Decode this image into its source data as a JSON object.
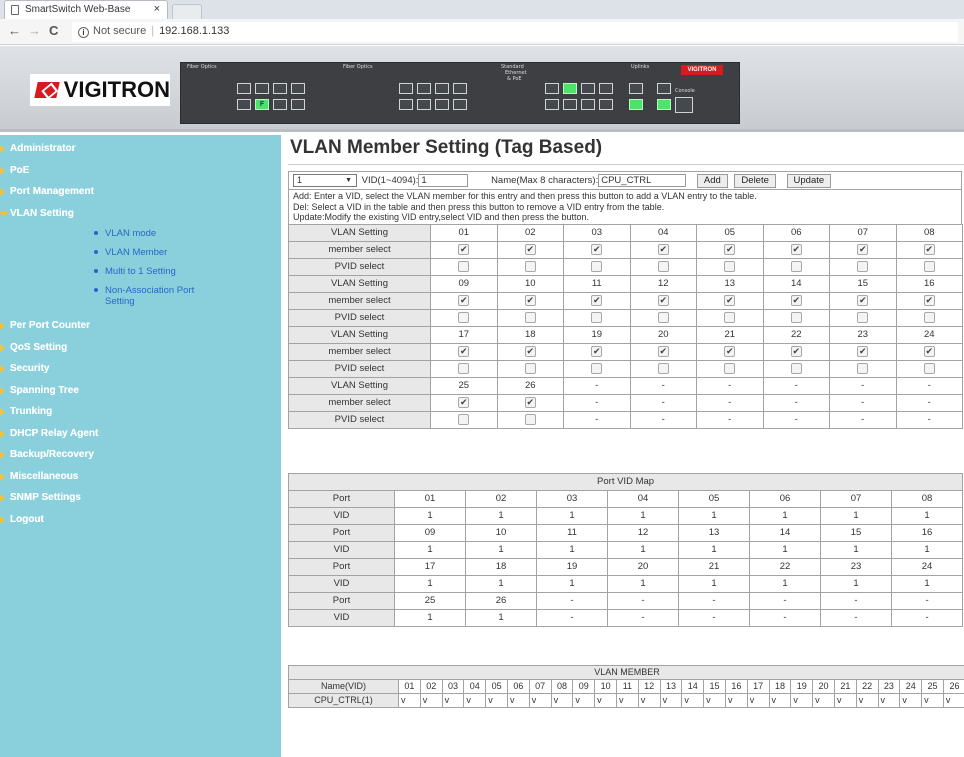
{
  "browser": {
    "tab_title": "SmartSwitch Web-Base",
    "tab_close": "×",
    "nav_back": "←",
    "nav_forward": "→",
    "nav_reload": "C",
    "security_label": "Not secure",
    "url": "192.168.1.133"
  },
  "banner": {
    "logo_text": "VIGITRON",
    "labels": {
      "fiber1": "Fiber Optics",
      "fiber2": "Fiber Optics",
      "standard": "Standard",
      "ethernet": "Ethernet",
      "poe": "& PoE",
      "uplinks": "Uplinks",
      "console": "Console",
      "brand": "VIGITRON",
      "f": "F"
    }
  },
  "sidebar": {
    "items": [
      {
        "label": "Administrator"
      },
      {
        "label": "PoE"
      },
      {
        "label": "Port Management"
      },
      {
        "label": "VLAN Setting"
      },
      {
        "label": "Per Port Counter"
      },
      {
        "label": "QoS Setting"
      },
      {
        "label": "Security"
      },
      {
        "label": "Spanning Tree"
      },
      {
        "label": "Trunking"
      },
      {
        "label": "DHCP Relay Agent"
      },
      {
        "label": "Backup/Recovery"
      },
      {
        "label": "Miscellaneous"
      },
      {
        "label": "SNMP Settings"
      },
      {
        "label": "Logout"
      }
    ],
    "vlan_sub": [
      {
        "label": "VLAN mode"
      },
      {
        "label": "VLAN Member"
      },
      {
        "label": "Multi to 1 Setting"
      },
      {
        "label": "Non-Association Port Setting"
      }
    ]
  },
  "main": {
    "title": "VLAN Member Setting (Tag Based)",
    "controls": {
      "vid_select_value": "1",
      "vid_label": "VID(1~4094):",
      "vid_value": "1",
      "name_label": "Name(Max 8 characters):",
      "name_value": "CPU_CTRL",
      "add_label": "Add",
      "delete_label": "Delete",
      "update_label": "Update"
    },
    "help": {
      "line1": "Add: Enter a VID, select the VLAN member for this entry and then press this button to add a VLAN entry to the table.",
      "line2": "Del: Select a VID in the table and then press this button to remove a VID entry from the table.",
      "line3": "Update:Modify the existing VID entry,select VID and then press the button."
    },
    "row_labels": {
      "setting": "VLAN Setting",
      "member": "member select",
      "pvid": "PVID select"
    },
    "member_groups": [
      {
        "ports": [
          "01",
          "02",
          "03",
          "04",
          "05",
          "06",
          "07",
          "08"
        ],
        "member": [
          true,
          true,
          true,
          true,
          true,
          true,
          true,
          true
        ],
        "pvid": [
          false,
          false,
          false,
          false,
          false,
          false,
          false,
          false
        ]
      },
      {
        "ports": [
          "09",
          "10",
          "11",
          "12",
          "13",
          "14",
          "15",
          "16"
        ],
        "member": [
          true,
          true,
          true,
          true,
          true,
          true,
          true,
          true
        ],
        "pvid": [
          false,
          false,
          false,
          false,
          false,
          false,
          false,
          false
        ]
      },
      {
        "ports": [
          "17",
          "18",
          "19",
          "20",
          "21",
          "22",
          "23",
          "24"
        ],
        "member": [
          true,
          true,
          true,
          true,
          true,
          true,
          true,
          true
        ],
        "pvid": [
          false,
          false,
          false,
          false,
          false,
          false,
          false,
          false
        ]
      },
      {
        "ports": [
          "25",
          "26",
          "-",
          "-",
          "-",
          "-",
          "-",
          "-"
        ],
        "member": [
          true,
          true,
          null,
          null,
          null,
          null,
          null,
          null
        ],
        "pvid": [
          false,
          false,
          null,
          null,
          null,
          null,
          null,
          null
        ]
      }
    ],
    "empty_cell": "-",
    "pvid_map": {
      "title": "Port VID Map",
      "port_label": "Port",
      "vid_label": "VID",
      "rows": [
        {
          "ports": [
            "01",
            "02",
            "03",
            "04",
            "05",
            "06",
            "07",
            "08"
          ],
          "vids": [
            "1",
            "1",
            "1",
            "1",
            "1",
            "1",
            "1",
            "1"
          ]
        },
        {
          "ports": [
            "09",
            "10",
            "11",
            "12",
            "13",
            "14",
            "15",
            "16"
          ],
          "vids": [
            "1",
            "1",
            "1",
            "1",
            "1",
            "1",
            "1",
            "1"
          ]
        },
        {
          "ports": [
            "17",
            "18",
            "19",
            "20",
            "21",
            "22",
            "23",
            "24"
          ],
          "vids": [
            "1",
            "1",
            "1",
            "1",
            "1",
            "1",
            "1",
            "1"
          ]
        },
        {
          "ports": [
            "25",
            "26",
            "-",
            "-",
            "-",
            "-",
            "-",
            "-"
          ],
          "vids": [
            "1",
            "1",
            "-",
            "-",
            "-",
            "-",
            "-",
            "-"
          ]
        }
      ]
    },
    "vlan_member": {
      "title": "VLAN MEMBER",
      "name_header": "Name(VID)",
      "ports": [
        "01",
        "02",
        "03",
        "04",
        "05",
        "06",
        "07",
        "08",
        "09",
        "10",
        "11",
        "12",
        "13",
        "14",
        "15",
        "16",
        "17",
        "18",
        "19",
        "20",
        "21",
        "22",
        "23",
        "24",
        "25",
        "26"
      ],
      "entries": [
        {
          "name": "CPU_CTRL(1)",
          "marks": [
            "v",
            "v",
            "v",
            "v",
            "v",
            "v",
            "v",
            "v",
            "v",
            "v",
            "v",
            "v",
            "v",
            "v",
            "v",
            "v",
            "v",
            "v",
            "v",
            "v",
            "v",
            "v",
            "v",
            "v",
            "v",
            "v"
          ]
        }
      ]
    }
  }
}
